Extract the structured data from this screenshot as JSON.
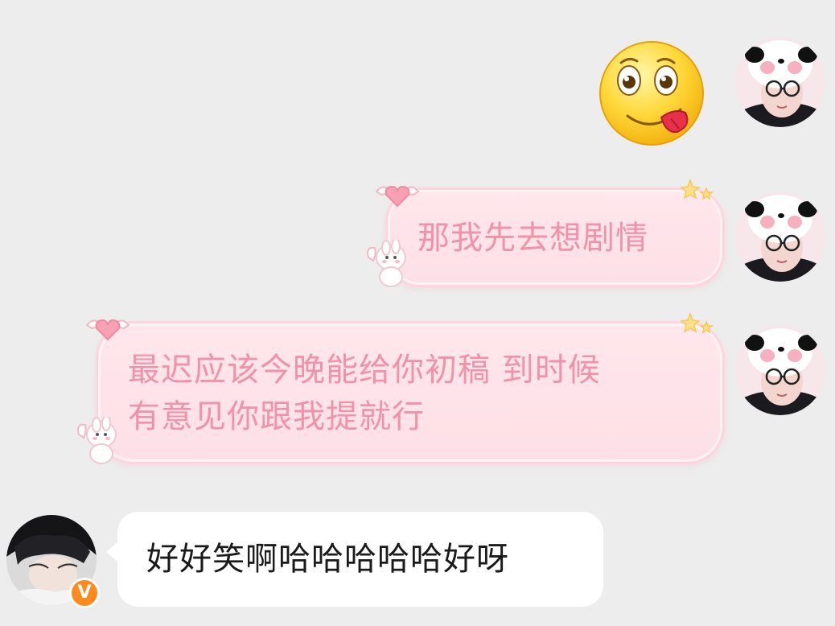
{
  "messages": [
    {
      "side": "right",
      "kind": "sticker",
      "sticker": "yummy-tongue-emoji"
    },
    {
      "side": "right",
      "kind": "text",
      "text": "那我先去想剧情"
    },
    {
      "side": "right",
      "kind": "text",
      "text": "最迟应该今晚能给你初稿 到时候\n有意见你跟我提就行"
    },
    {
      "side": "left",
      "kind": "text",
      "text": "好好笑啊哈哈哈哈哈好呀"
    }
  ],
  "self_avatar_icon": "panda-hat-avatar",
  "friend_avatar_icon": "dark-hair-avatar",
  "friend_badge": "V",
  "colors": {
    "background": "#ededed",
    "pink_bubble_text": "#f092a8",
    "pink_bubble_fill": "#ffe4ea",
    "white_bubble_fill": "#ffffff",
    "badge_orange": "#ff8a1e"
  }
}
